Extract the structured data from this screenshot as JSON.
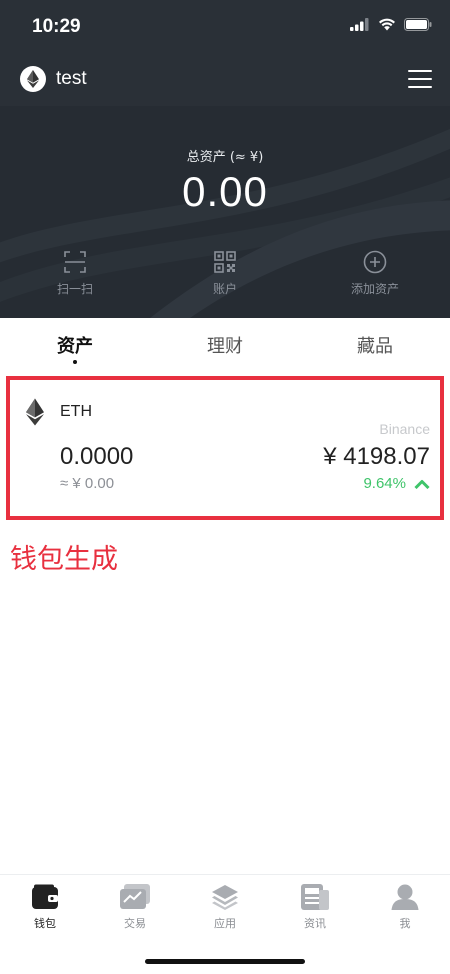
{
  "status_bar": {
    "time": "10:29"
  },
  "wallet": {
    "name": "test"
  },
  "summary": {
    "label": "总资产 (≈ ¥)",
    "value": "0.00"
  },
  "actions": [
    {
      "label": "扫一扫",
      "icon": "scan-icon"
    },
    {
      "label": "账户",
      "icon": "qr-code-icon"
    },
    {
      "label": "添加资产",
      "icon": "add-circle-icon"
    }
  ],
  "tabs": [
    {
      "label": "资产",
      "active": true
    },
    {
      "label": "理财",
      "active": false
    },
    {
      "label": "藏品",
      "active": false
    }
  ],
  "assets": [
    {
      "symbol": "ETH",
      "exchange": "Binance",
      "balance": "0.0000",
      "fiat_value": "≈ ¥ 0.00",
      "price": "¥ 4198.07",
      "change": "9.64%"
    }
  ],
  "annotation": "钱包生成",
  "bottom_nav": [
    {
      "label": "钱包",
      "icon": "wallet-icon",
      "active": true
    },
    {
      "label": "交易",
      "icon": "trade-chart-icon",
      "active": false
    },
    {
      "label": "应用",
      "icon": "layers-icon",
      "active": false
    },
    {
      "label": "资讯",
      "icon": "news-icon",
      "active": false
    },
    {
      "label": "我",
      "icon": "profile-icon",
      "active": false
    }
  ],
  "colors": {
    "header_bg": "#23292f",
    "highlight_red": "#e8303f",
    "positive_green": "#3fc46a"
  }
}
